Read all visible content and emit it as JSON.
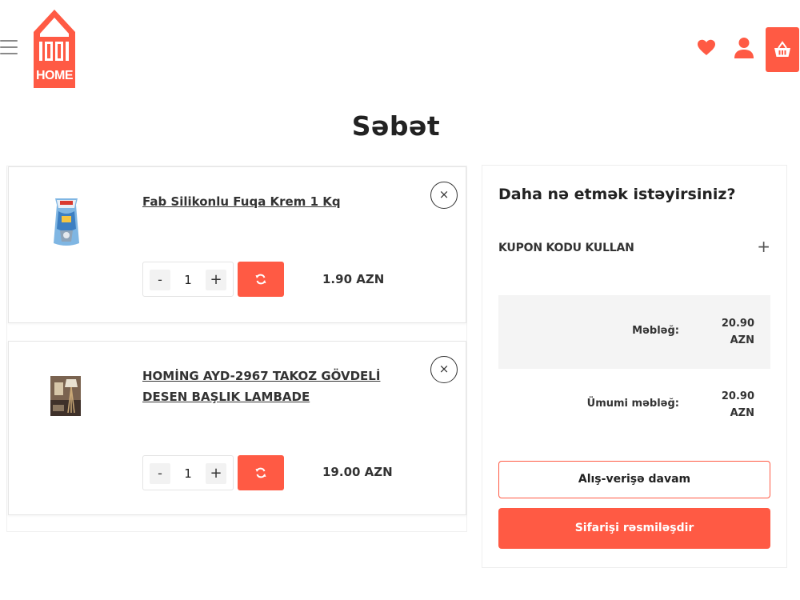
{
  "header": {
    "logo_text": "HOME",
    "menu_icon": "hamburger-menu-icon",
    "wishlist_icon": "heart-icon",
    "account_icon": "user-icon",
    "cart_icon": "basket-icon"
  },
  "page_title": "Səbət",
  "cart": {
    "items": [
      {
        "name": "Fab Silikonlu Fuqa Krem 1 Kq",
        "quantity": "1",
        "minus_label": "-",
        "plus_label": "+",
        "remove_label": "×",
        "price": "1.90 AZN"
      },
      {
        "name": "HOMİNG AYD-2967 TAKOZ GÖVDELİ DESEN BAŞLIK LAMBADE",
        "quantity": "1",
        "minus_label": "-",
        "plus_label": "+",
        "remove_label": "×",
        "price": "19.00 AZN"
      }
    ]
  },
  "summary": {
    "title": "Daha nə etmək istəyirsiniz?",
    "coupon_label": "KUPON KODU KULLAN",
    "coupon_toggle": "+",
    "subtotal_label": "Məbləğ:",
    "subtotal_amount": "20.90",
    "subtotal_currency": "AZN",
    "total_label": "Ümumi məbləğ:",
    "total_amount": "20.90",
    "total_currency": "AZN",
    "continue_label": "Alış-verişə davam",
    "checkout_label": "Sifarişi rəsmiləşdir"
  },
  "colors": {
    "accent": "#ff5a44",
    "text": "#222222",
    "muted_bg": "#f4f4f4"
  }
}
